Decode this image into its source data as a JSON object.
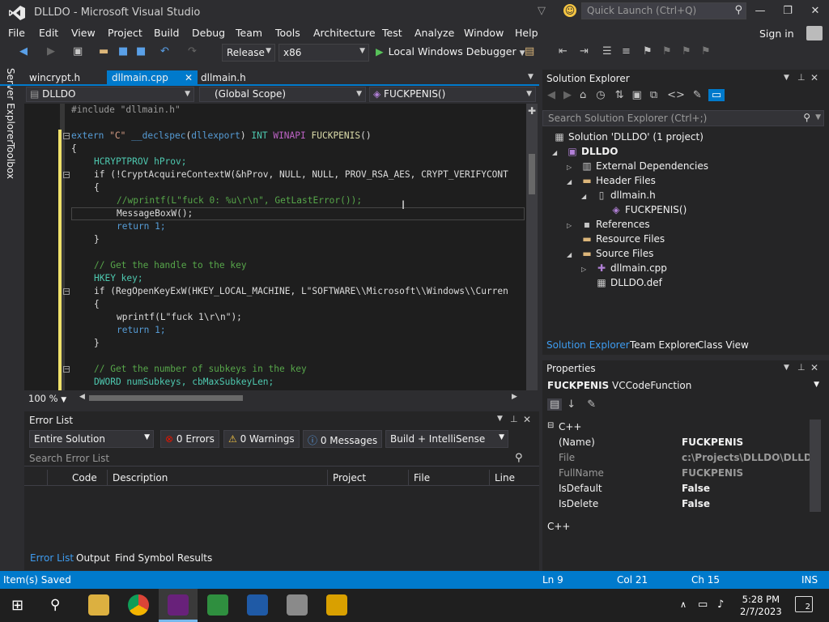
{
  "window": {
    "title": "DLLDO - Microsoft Visual Studio",
    "quick_launch": "Quick Launch (Ctrl+Q)"
  },
  "menu": [
    "File",
    "Edit",
    "View",
    "Project",
    "Build",
    "Debug",
    "Team",
    "Tools",
    "Architecture",
    "Test",
    "Analyze",
    "Window",
    "Help"
  ],
  "signin": "Sign in",
  "toolbar": {
    "config": "Release",
    "platform": "x86",
    "run": "Local Windows Debugger"
  },
  "tabs": [
    {
      "label": "wincrypt.h"
    },
    {
      "label": "dllmain.cpp"
    },
    {
      "label": "dllmain.h"
    }
  ],
  "nav": {
    "project": "DLLDO",
    "scope": "(Global Scope)",
    "member": "FUCKPENIS()"
  },
  "side_tabs": [
    "Server Explorer",
    "Toolbox"
  ],
  "code": {
    "l1": "#include \"dllmain.h\"",
    "l2a": "extern \"C\" __declspec(dllexport) INT WINAPI FUCKPENIS()",
    "brace_open": "{",
    "l4": "HCRYPTPROV hProv;",
    "l5": "if (!CryptAcquireContextW(&hProv, NULL, NULL, PROV_RSA_AES, CRYPT_VERIFYCONT",
    "l7": "//wprintf(L\"fuck 0: %u\\r\\n\", GetLastError());",
    "l8": "MessageBoxW();",
    "ret": "return 1;",
    "brace_close": "}",
    "c1": "// Get the handle to the key",
    "l11": "HKEY key;",
    "l12": "if (RegOpenKeyExW(HKEY_LOCAL_MACHINE, L\"SOFTWARE\\\\Microsoft\\\\Windows\\\\Curren",
    "l14": "wprintf(L\"fuck 1\\r\\n\");",
    "c2": "// Get the number of subkeys in the key",
    "l18": "DWORD numSubkeys, cbMaxSubkeyLen;"
  },
  "zoom": "100 %",
  "error_list": {
    "title": "Error List",
    "scope": "Entire Solution",
    "errors": "0 Errors",
    "warnings": "0 Warnings",
    "messages": "0 Messages",
    "build": "Build + IntelliSense",
    "search": "Search Error List",
    "columns": [
      "Code",
      "Description",
      "Project",
      "File",
      "Line"
    ],
    "bottom_tabs": [
      "Error List",
      "Output",
      "Find Symbol Results"
    ]
  },
  "solution_explorer": {
    "title": "Solution Explorer",
    "search": "Search Solution Explorer (Ctrl+;)",
    "solution": "Solution 'DLLDO' (1 project)",
    "project": "DLLDO",
    "ext_deps": "External Dependencies",
    "header_files": "Header Files",
    "dllmain_h": "dllmain.h",
    "fuck_fn": "FUCKPENIS()",
    "references": "References",
    "resource_files": "Resource Files",
    "source_files": "Source Files",
    "dllmain_cpp": "dllmain.cpp",
    "dlldo_def": "DLLDO.def",
    "tabs": [
      "Solution Explorer",
      "Team Explorer",
      "Class View"
    ]
  },
  "properties": {
    "title": "Properties",
    "object": "FUCKPENIS",
    "object_type": "VCCodeFunction",
    "category": "C++",
    "rows": [
      {
        "name": "(Name)",
        "value": "FUCKPENIS"
      },
      {
        "name": "File",
        "value": "c:\\Projects\\DLLDO\\DLLDO\\d"
      },
      {
        "name": "FullName",
        "value": "FUCKPENIS"
      },
      {
        "name": "IsDefault",
        "value": "False"
      },
      {
        "name": "IsDelete",
        "value": "False"
      }
    ],
    "desc": "C++"
  },
  "status": {
    "left": "Item(s) Saved",
    "ln": "Ln 9",
    "col": "Col 21",
    "ch": "Ch 15",
    "mode": "INS"
  },
  "taskbar": {
    "time": "5:28 PM",
    "date": "2/7/2023",
    "notifications": "2"
  },
  "colors": {
    "accent": "#007acc",
    "editor_bg": "#1e1e1e",
    "chrome_bg": "#2d2d30"
  }
}
